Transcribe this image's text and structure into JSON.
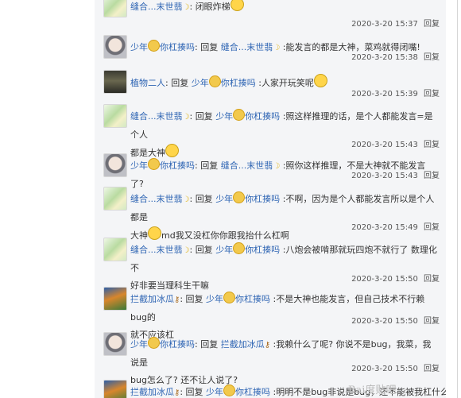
{
  "reply_link_label": "回复",
  "reply_word": "回复",
  "sep": ":",
  "users": {
    "u1": "缝合...末世翡",
    "u2": "少年",
    "u2b": "你杠揍吗",
    "u3": "植物二人",
    "u4": "拦截加冰瓜"
  },
  "comments": [
    {
      "text": "闭眼炸梯",
      "time": "2020-3-20 15:37"
    },
    {
      "text": "能发言的都是大神，菜鸡就得闭嘴!",
      "time": "2020-3-20 15:38"
    },
    {
      "text": "人家开玩笑呢",
      "time": "2020-3-20 15:39"
    },
    {
      "text1": "照这样推理的话，是个人都能发言=是个人",
      "text2": "都是大神",
      "time": "2020-3-20 15:43"
    },
    {
      "text": "照你这样推理，不是大神就不能发言了?",
      "time": "2020-3-20 15:43"
    },
    {
      "text1": "不啊，因为是个人都能发言所以是个人都是",
      "text2a": "大神",
      "text2b": "md我又没杠你你跟我抬什么杠啊",
      "time": "2020-3-20 15:49"
    },
    {
      "text1": "八炮会被啃那就玩四炮不就行了 数理化不",
      "text2": "好非要当理科生干嘛",
      "time": "2020-3-20 15:50"
    },
    {
      "text1": "不是大神也能发言，但自己技术不行赖bug的",
      "text2": "就不应该杠",
      "time": "2020-3-20 15:50"
    },
    {
      "text1": "我赖什么了呢? 你说不是bug，我菜，我说是",
      "text2": "bug怎么了? 还不让人说了?",
      "time": "2020-3-20 15:50"
    },
    {
      "text": "明明不是bug非说是bug，还不能被我杠什么"
    }
  ],
  "watermark": "Bai度贴吧"
}
